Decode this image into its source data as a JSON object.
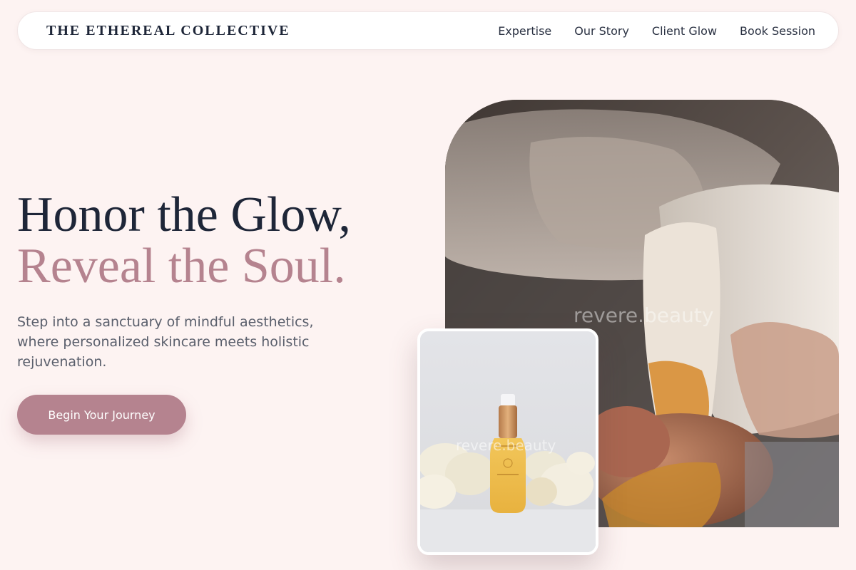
{
  "brand": "THE ETHEREAL COLLECTIVE",
  "nav": {
    "links": [
      "Expertise",
      "Our Story",
      "Client Glow",
      "Book Session"
    ]
  },
  "hero": {
    "title_line1": "Honor the Glow,",
    "title_line2": "Reveal the Soul.",
    "subtitle": "Step into a sanctuary of mindful aesthetics, where personalized skincare meets holistic rejuvenation.",
    "cta_label": "Begin Your Journey"
  },
  "images": {
    "main_watermark": "revere.beauty",
    "product_watermark": "revere.beauty"
  },
  "colors": {
    "background": "#fdf3f2",
    "accent": "#b5838f",
    "heading": "#1e2638"
  }
}
